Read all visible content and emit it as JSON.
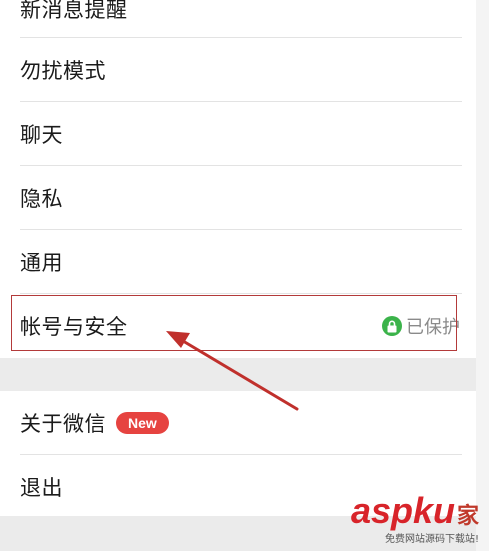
{
  "settings": {
    "items": [
      {
        "label": "新消息提醒"
      },
      {
        "label": "勿扰模式"
      },
      {
        "label": "聊天"
      },
      {
        "label": "隐私"
      },
      {
        "label": "通用"
      },
      {
        "label": "帐号与安全",
        "status": "已保护",
        "status_icon": "lock-icon"
      },
      {
        "label": "关于微信",
        "badge": "New"
      },
      {
        "label": "退出"
      }
    ]
  },
  "annotation": {
    "highlight_color": "#b33a3a",
    "arrow_color": "#c0302c",
    "lock_color": "#3bb34a",
    "badge_color": "#e64340"
  },
  "watermark": {
    "brand": "aspku",
    "brand_suffix": "家",
    "subtitle": "免费网站源码下载站!"
  }
}
